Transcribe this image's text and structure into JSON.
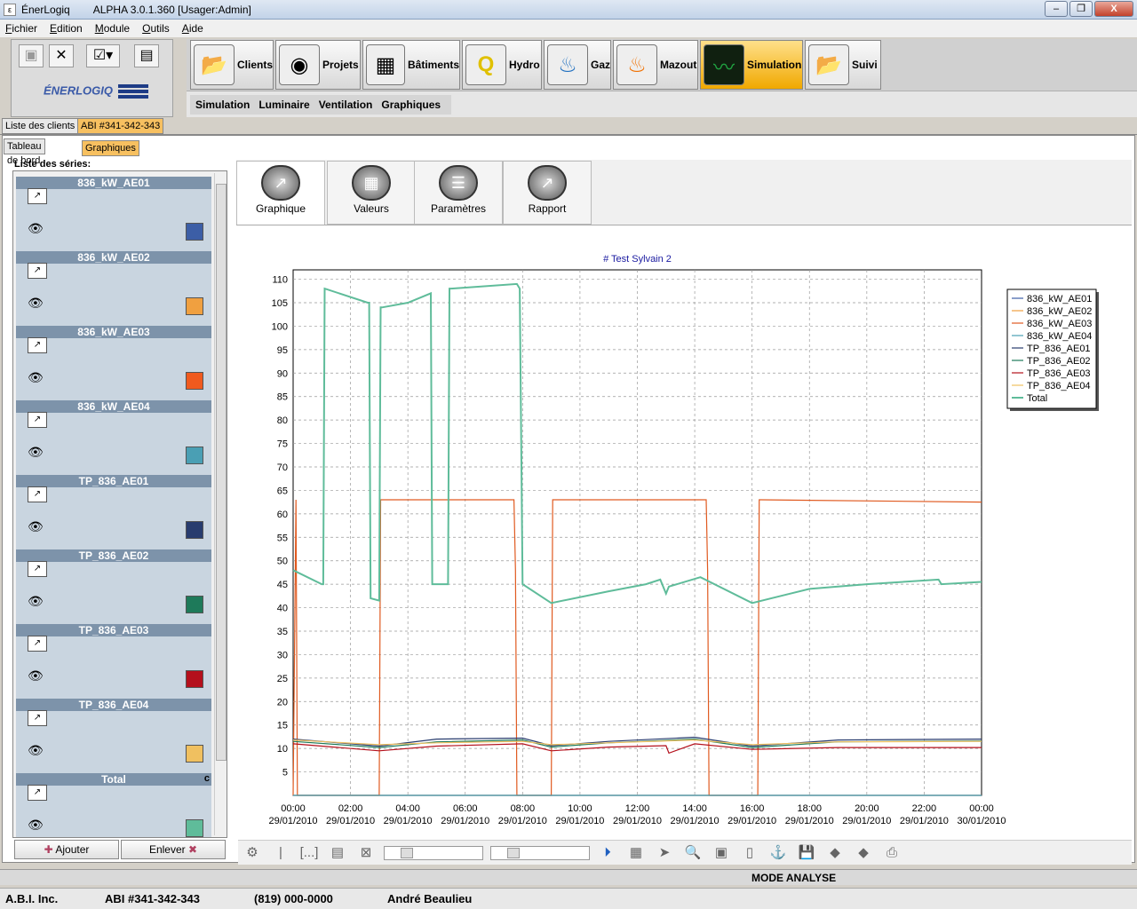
{
  "window": {
    "app_name": "ÉnerLogiq",
    "title": "ALPHA 3.0.1.360  [Usager:Admin]",
    "min": "–",
    "max": "❐",
    "close": "X"
  },
  "menu": [
    "Fichier",
    "Edition",
    "Module",
    "Outils",
    "Aide"
  ],
  "logo_text": "ÉNERLOGIQ",
  "modules": [
    {
      "label": "Clients",
      "icon": "folder-icon"
    },
    {
      "label": "Projets",
      "icon": "projects-icon"
    },
    {
      "label": "Bâtiments",
      "icon": "building-icon"
    },
    {
      "label": "Hydro",
      "icon": "hydro-icon"
    },
    {
      "label": "Gaz",
      "icon": "gas-flame-icon"
    },
    {
      "label": "Mazout",
      "icon": "oil-flame-icon"
    },
    {
      "label": "Simulation",
      "icon": "monitor-icon"
    },
    {
      "label": "Suivi",
      "icon": "folder-icon"
    }
  ],
  "subnav": [
    "Simulation",
    "Luminaire",
    "Ventilation",
    "Graphiques"
  ],
  "doc_tabs": [
    "Liste des clients",
    "ABI #341-342-343"
  ],
  "inner_tabs": [
    "Tableau de bord",
    "Graphiques"
  ],
  "series_list_title": "Liste des séries:",
  "series": [
    {
      "name": "836_kW_AE01",
      "color": "#3c5ea6"
    },
    {
      "name": "836_kW_AE02",
      "color": "#f0a040"
    },
    {
      "name": "836_kW_AE03",
      "color": "#f05a1e"
    },
    {
      "name": "836_kW_AE04",
      "color": "#4a9fb4"
    },
    {
      "name": "TP_836_AE01",
      "color": "#283c6e"
    },
    {
      "name": "TP_836_AE02",
      "color": "#1e7a5a"
    },
    {
      "name": "TP_836_AE03",
      "color": "#b4101c"
    },
    {
      "name": "TP_836_AE04",
      "color": "#f0c060"
    },
    {
      "name": "Total",
      "color": "#5fbc9a",
      "flag": "c"
    }
  ],
  "buttons": {
    "add": "Ajouter",
    "remove": "Enlever"
  },
  "view_tabs": [
    "Graphique",
    "Valeurs",
    "Paramètres",
    "Rapport"
  ],
  "mode_text": "MODE ANALYSE",
  "status": {
    "company": "A.B.I. Inc.",
    "project": "ABI #341-342-343",
    "phone": "(819) 000-0000",
    "user": "André Beaulieu"
  },
  "chart_data": {
    "type": "line",
    "title": "# Test Sylvain 2",
    "ylim": [
      0,
      112
    ],
    "yticks": [
      5,
      10,
      15,
      20,
      25,
      30,
      35,
      40,
      45,
      50,
      55,
      60,
      65,
      70,
      75,
      80,
      85,
      90,
      95,
      100,
      105,
      110
    ],
    "xticks": [
      [
        "00:00",
        "29/01/2010"
      ],
      [
        "02:00",
        "29/01/2010"
      ],
      [
        "04:00",
        "29/01/2010"
      ],
      [
        "06:00",
        "29/01/2010"
      ],
      [
        "08:00",
        "29/01/2010"
      ],
      [
        "10:00",
        "29/01/2010"
      ],
      [
        "12:00",
        "29/01/2010"
      ],
      [
        "14:00",
        "29/01/2010"
      ],
      [
        "16:00",
        "29/01/2010"
      ],
      [
        "18:00",
        "29/01/2010"
      ],
      [
        "20:00",
        "29/01/2010"
      ],
      [
        "22:00",
        "29/01/2010"
      ],
      [
        "00:00",
        "30/01/2010"
      ]
    ],
    "xlim": [
      0,
      24
    ],
    "grid": true,
    "legend_position": "right",
    "series": [
      {
        "name": "836_kW_AE01",
        "color": "#3c5ea6",
        "x": [
          0,
          1,
          3,
          5,
          8,
          9,
          11,
          14,
          16,
          19,
          24
        ],
        "y": [
          0,
          0,
          0,
          0,
          0,
          0,
          0,
          0,
          0,
          0,
          0
        ]
      },
      {
        "name": "836_kW_AE02",
        "color": "#f0a040",
        "x": [
          0,
          24
        ],
        "y": [
          0,
          0
        ]
      },
      {
        "name": "836_kW_AE03",
        "color": "#e05a20",
        "x": [
          0,
          0.1,
          0.15,
          3,
          3.05,
          3.1,
          7.7,
          7.75,
          7.8,
          9,
          9.05,
          9.1,
          14.4,
          14.45,
          14.5,
          16.2,
          16.25,
          16.3,
          24
        ],
        "y": [
          0,
          63,
          0,
          0,
          63,
          63,
          63,
          48,
          0,
          0,
          63,
          63,
          63,
          48,
          0,
          0,
          63,
          63,
          62.5
        ]
      },
      {
        "name": "836_kW_AE04",
        "color": "#4a9fb4",
        "x": [
          0,
          24
        ],
        "y": [
          0,
          0
        ]
      },
      {
        "name": "TP_836_AE01",
        "color": "#283c6e",
        "x": [
          0,
          3,
          5,
          8,
          9,
          11,
          14,
          16,
          19,
          24
        ],
        "y": [
          12,
          10.5,
          12,
          12.2,
          10.6,
          11.5,
          12.4,
          10.5,
          11.8,
          12
        ]
      },
      {
        "name": "TP_836_AE02",
        "color": "#1e7a5a",
        "x": [
          0,
          3,
          5,
          8,
          9,
          11,
          14,
          16,
          19,
          24
        ],
        "y": [
          11.5,
          10.2,
          11.4,
          11.8,
          10.3,
          11.2,
          12.0,
          10.2,
          11.4,
          11.6
        ]
      },
      {
        "name": "TP_836_AE03",
        "color": "#b4101c",
        "x": [
          0,
          3,
          5,
          8,
          9,
          11,
          13,
          13.1,
          14,
          16,
          19,
          24
        ],
        "y": [
          11,
          9.5,
          10.5,
          11,
          9.5,
          10.3,
          10.6,
          9.0,
          11,
          9.8,
          10.2,
          10.2
        ]
      },
      {
        "name": "TP_836_AE04",
        "color": "#f0c060",
        "x": [
          0,
          3,
          5,
          8,
          9,
          11,
          14,
          16,
          19,
          24
        ],
        "y": [
          11.8,
          10.8,
          11.2,
          11.5,
          10.8,
          11.2,
          11.8,
          10.8,
          11.4,
          11.5
        ]
      },
      {
        "name": "Total",
        "color": "#5fbc9a",
        "x": [
          0,
          1,
          1.05,
          1.1,
          2.6,
          2.65,
          2.7,
          3,
          3.05,
          3.1,
          4,
          4.8,
          4.85,
          4.9,
          5.4,
          5.45,
          5.5,
          7.8,
          7.9,
          8,
          9,
          11,
          12.3,
          12.8,
          13,
          13.1,
          14.2,
          16,
          18,
          20,
          22.5,
          22.6,
          24
        ],
        "y": [
          48,
          45,
          45,
          108,
          105,
          105,
          42,
          41.5,
          104,
          104,
          105,
          107,
          45,
          45,
          45,
          108,
          108,
          109,
          108,
          45,
          41,
          43.5,
          45,
          46,
          43,
          44.5,
          46.5,
          41,
          44,
          45,
          46,
          45,
          45.5
        ]
      }
    ]
  }
}
